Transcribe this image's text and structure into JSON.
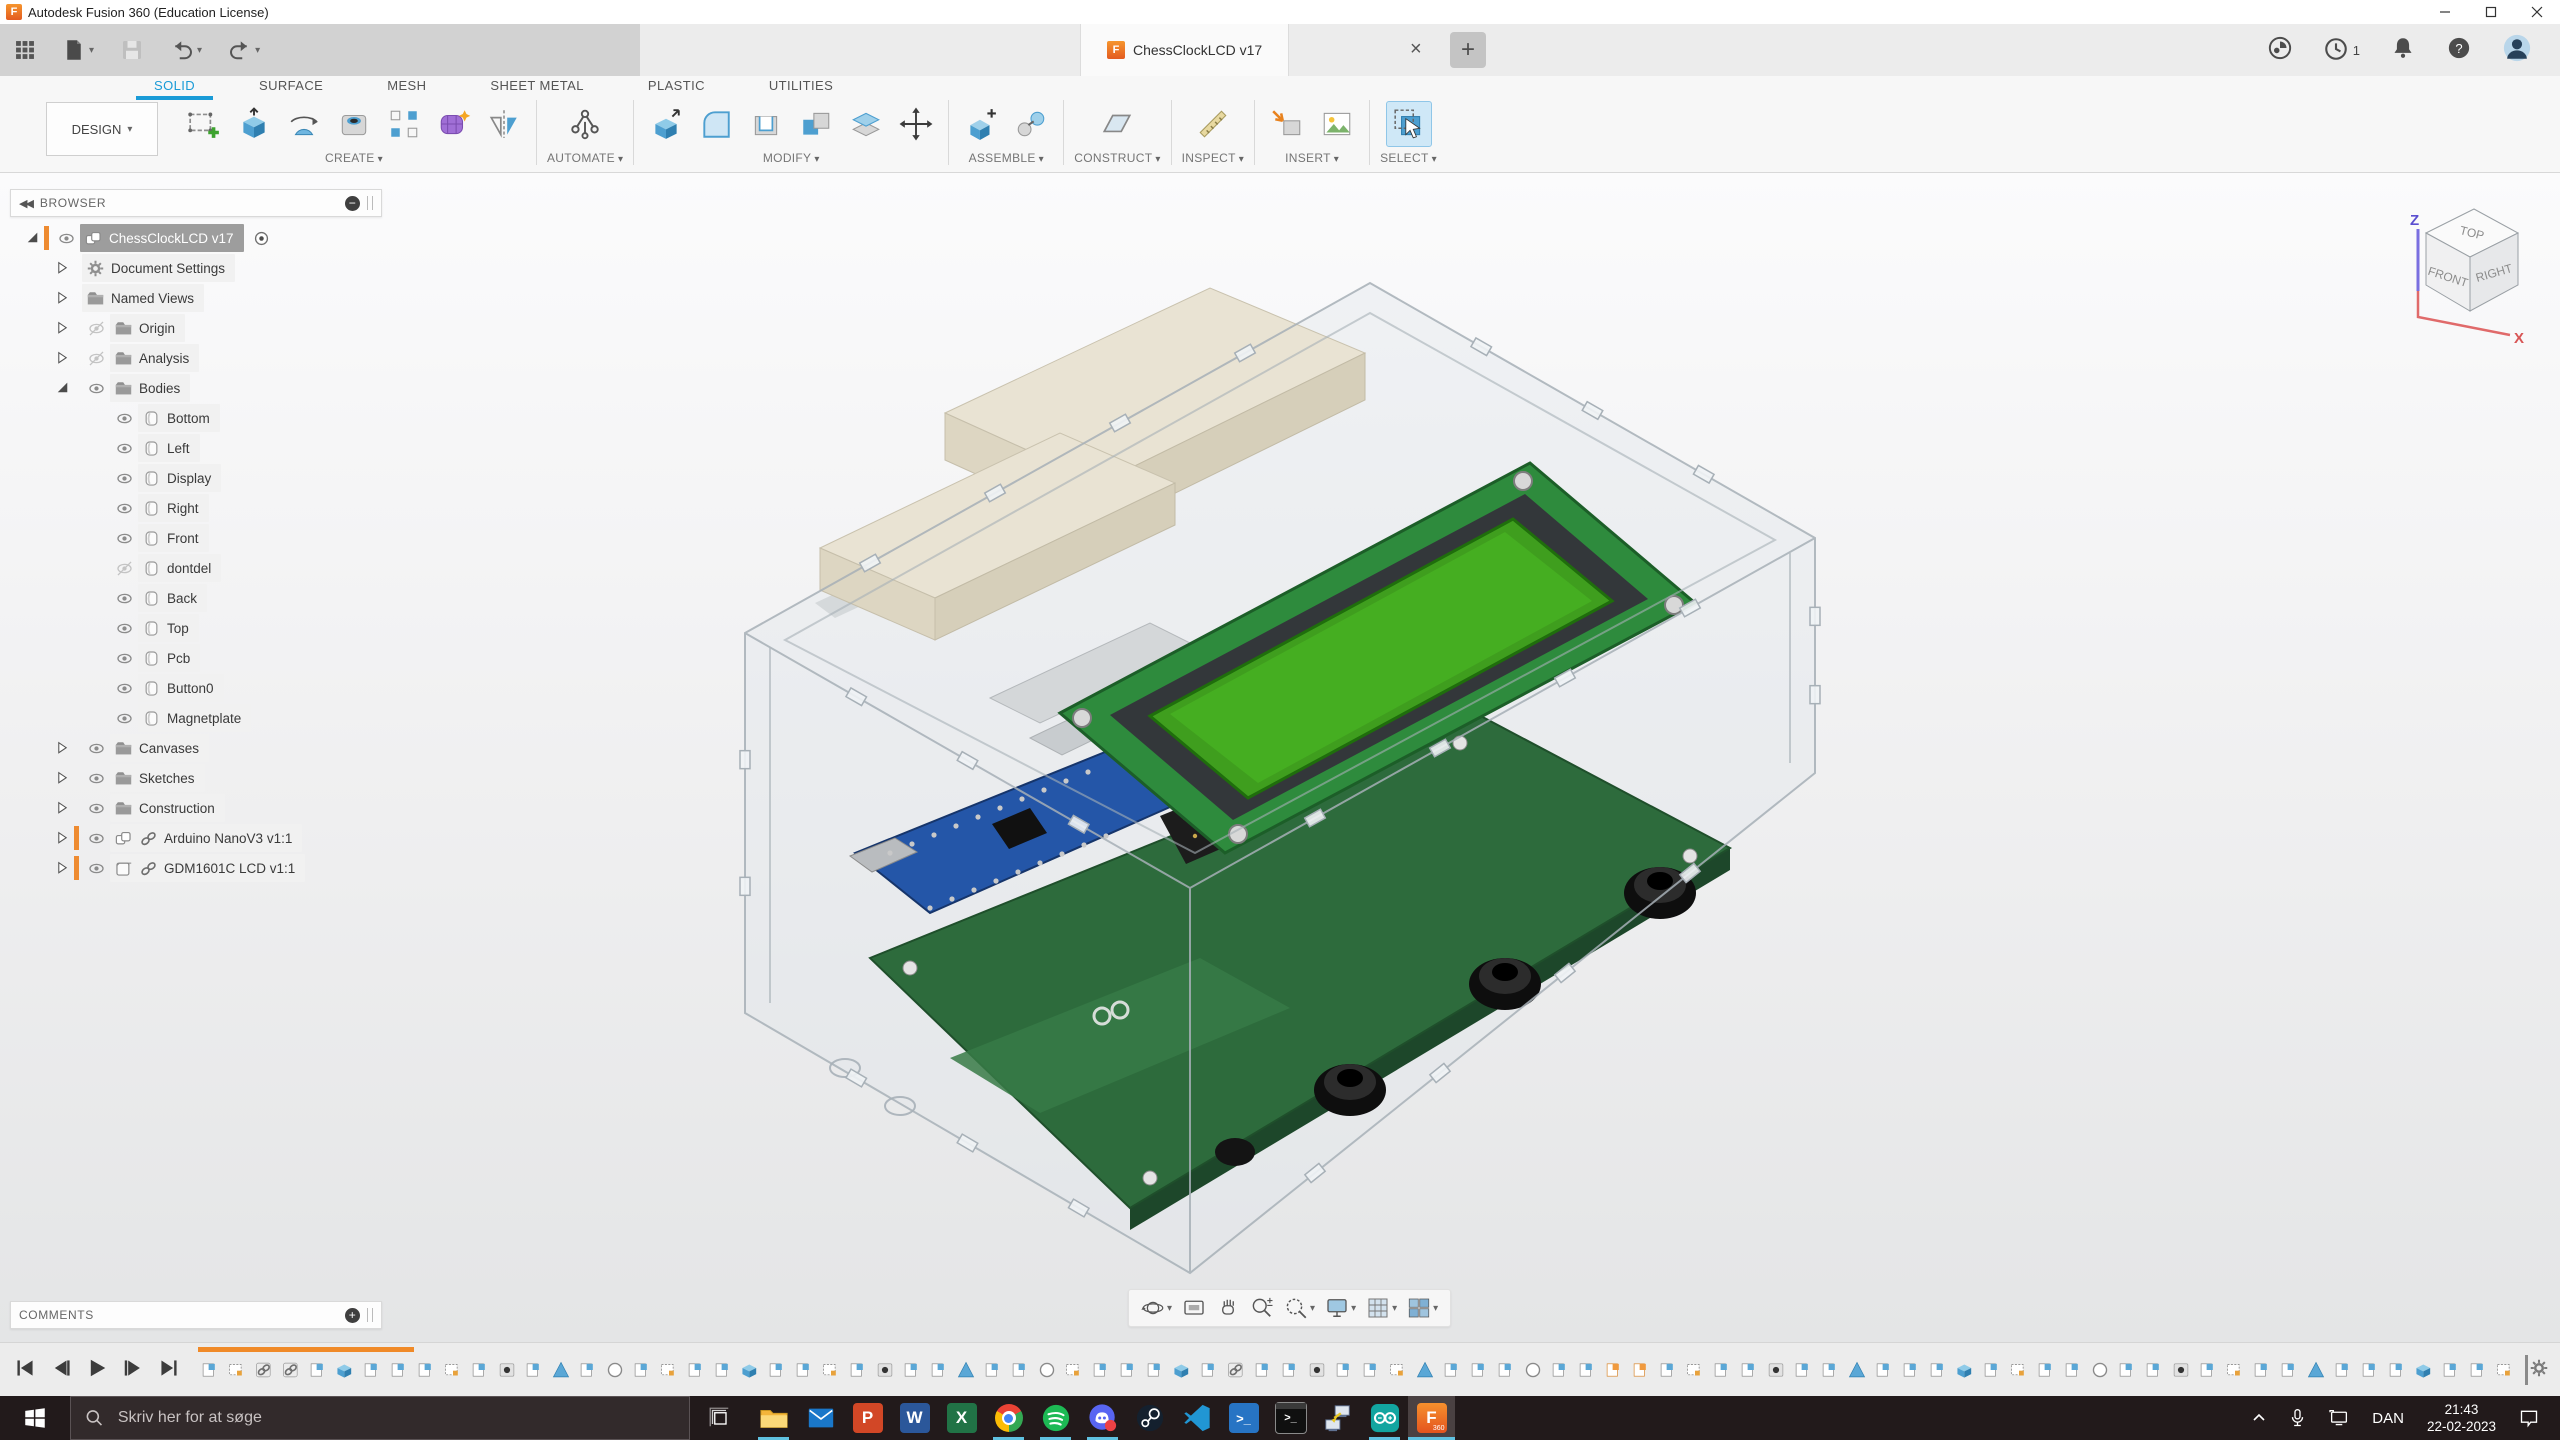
{
  "window": {
    "app_title": "Autodesk Fusion 360 (Education License)"
  },
  "doc_tabs": {
    "active_title": "ChessClockLCD v17",
    "jobs_badge": "1"
  },
  "ribbon": {
    "design_menu": "DESIGN",
    "tabs": [
      {
        "label": "SOLID",
        "active": true
      },
      {
        "label": "SURFACE",
        "active": false
      },
      {
        "label": "MESH",
        "active": false
      },
      {
        "label": "SHEET METAL",
        "active": false
      },
      {
        "label": "PLASTIC",
        "active": false
      },
      {
        "label": "UTILITIES",
        "active": false
      }
    ],
    "groups": [
      {
        "label": "CREATE",
        "icons": [
          "create-sketch",
          "extrude",
          "revolve",
          "hole",
          "pattern",
          "form",
          "mirror"
        ]
      },
      {
        "label": "AUTOMATE",
        "icons": [
          "automate"
        ]
      },
      {
        "label": "MODIFY",
        "icons": [
          "press-pull",
          "fillet",
          "shell",
          "combine",
          "offset-face",
          "move"
        ]
      },
      {
        "label": "ASSEMBLE",
        "icons": [
          "new-component",
          "joint"
        ]
      },
      {
        "label": "CONSTRUCT",
        "icons": [
          "construction-plane"
        ]
      },
      {
        "label": "INSPECT",
        "icons": [
          "measure"
        ]
      },
      {
        "label": "INSERT",
        "icons": [
          "insert-derive",
          "canvas"
        ]
      },
      {
        "label": "SELECT",
        "icons": [
          "select"
        ]
      }
    ]
  },
  "browser": {
    "header": "BROWSER",
    "items": [
      {
        "label": "ChessClockLCD v17",
        "level": 0,
        "exp": "e",
        "eye": "on",
        "icon": "component",
        "link": false,
        "orange": true,
        "selected": true,
        "activate": true
      },
      {
        "label": "Document Settings",
        "level": 1,
        "exp": "c",
        "eye": null,
        "icon": "gear",
        "link": false,
        "orange": false,
        "selected": false,
        "activate": false
      },
      {
        "label": "Named Views",
        "level": 1,
        "exp": "c",
        "eye": null,
        "icon": "folder",
        "link": false,
        "orange": false,
        "selected": false,
        "activate": false
      },
      {
        "label": "Origin",
        "level": 1,
        "exp": "c",
        "eye": "off",
        "icon": "folder",
        "link": false,
        "orange": false,
        "selected": false,
        "activate": false
      },
      {
        "label": "Analysis",
        "level": 1,
        "exp": "c",
        "eye": "off",
        "icon": "folder",
        "link": false,
        "orange": false,
        "selected": false,
        "activate": false
      },
      {
        "label": "Bodies",
        "level": 1,
        "exp": "e",
        "eye": "on",
        "icon": "folder",
        "link": false,
        "orange": false,
        "selected": false,
        "activate": false
      },
      {
        "label": "Bottom",
        "level": 2,
        "exp": null,
        "eye": "on",
        "icon": "body",
        "link": false,
        "orange": false,
        "selected": false,
        "activate": false
      },
      {
        "label": "Left",
        "level": 2,
        "exp": null,
        "eye": "on",
        "icon": "body",
        "link": false,
        "orange": false,
        "selected": false,
        "activate": false
      },
      {
        "label": "Display",
        "level": 2,
        "exp": null,
        "eye": "on",
        "icon": "body",
        "link": false,
        "orange": false,
        "selected": false,
        "activate": false
      },
      {
        "label": "Right",
        "level": 2,
        "exp": null,
        "eye": "on",
        "icon": "body",
        "link": false,
        "orange": false,
        "selected": false,
        "activate": false
      },
      {
        "label": "Front",
        "level": 2,
        "exp": null,
        "eye": "on",
        "icon": "body",
        "link": false,
        "orange": false,
        "selected": false,
        "activate": false
      },
      {
        "label": "dontdel",
        "level": 2,
        "exp": null,
        "eye": "off",
        "icon": "body",
        "link": false,
        "orange": false,
        "selected": false,
        "activate": false
      },
      {
        "label": "Back",
        "level": 2,
        "exp": null,
        "eye": "on",
        "icon": "body",
        "link": false,
        "orange": false,
        "selected": false,
        "activate": false
      },
      {
        "label": "Top",
        "level": 2,
        "exp": null,
        "eye": "on",
        "icon": "body",
        "link": false,
        "orange": false,
        "selected": false,
        "activate": false
      },
      {
        "label": "Pcb",
        "level": 2,
        "exp": null,
        "eye": "on",
        "icon": "body",
        "link": false,
        "orange": false,
        "selected": false,
        "activate": false
      },
      {
        "label": "Button0",
        "level": 2,
        "exp": null,
        "eye": "on",
        "icon": "body",
        "link": false,
        "orange": false,
        "selected": false,
        "activate": false
      },
      {
        "label": "Magnetplate",
        "level": 2,
        "exp": null,
        "eye": "on",
        "icon": "body",
        "link": false,
        "orange": false,
        "selected": false,
        "activate": false
      },
      {
        "label": "Canvases",
        "level": 1,
        "exp": "c",
        "eye": "on",
        "icon": "folder",
        "link": false,
        "orange": false,
        "selected": false,
        "activate": false
      },
      {
        "label": "Sketches",
        "level": 1,
        "exp": "c",
        "eye": "on",
        "icon": "folder",
        "link": false,
        "orange": false,
        "selected": false,
        "activate": false
      },
      {
        "label": "Construction",
        "level": 1,
        "exp": "c",
        "eye": "on",
        "icon": "folder",
        "link": false,
        "orange": false,
        "selected": false,
        "activate": false
      },
      {
        "label": "Arduino NanoV3 v1:1",
        "level": 1,
        "exp": "c",
        "eye": "on",
        "icon": "component",
        "link": true,
        "orange": true,
        "selected": false,
        "activate": false
      },
      {
        "label": "GDM1601C LCD v1:1",
        "level": 1,
        "exp": "c",
        "eye": "on",
        "icon": "cube",
        "link": true,
        "orange": true,
        "selected": false,
        "activate": false
      }
    ]
  },
  "viewcube": {
    "top": "TOP",
    "front": "FRONT",
    "right": "RIGHT",
    "z_axis": "Z",
    "x_axis": "X"
  },
  "comments": {
    "header": "COMMENTS"
  },
  "navbar": {
    "icons": [
      "orbit",
      "look-at",
      "pan",
      "zoom",
      "window-zoom",
      "display-settings",
      "grid-settings",
      "viewports"
    ],
    "dropdown_after": [
      "orbit",
      "window-zoom",
      "display-settings",
      "grid-settings",
      "viewports"
    ]
  },
  "timeline": {
    "icon_count": 86,
    "orange_bar_icons": 8,
    "orange_icon_indices": [
      52,
      53
    ]
  },
  "taskbar": {
    "search_placeholder": "Skriv her for at søge",
    "language": "DAN",
    "time": "21:43",
    "date": "22-02-2023",
    "apps": [
      {
        "name": "file-explorer",
        "running": true,
        "active": false
      },
      {
        "name": "mail",
        "running": false,
        "active": false
      },
      {
        "name": "powerpoint",
        "running": false,
        "active": false
      },
      {
        "name": "word",
        "running": false,
        "active": false
      },
      {
        "name": "excel",
        "running": false,
        "active": false
      },
      {
        "name": "chrome",
        "running": true,
        "active": false
      },
      {
        "name": "spotify",
        "running": true,
        "active": false
      },
      {
        "name": "discord",
        "running": true,
        "active": false
      },
      {
        "name": "steam",
        "running": false,
        "active": false
      },
      {
        "name": "vscode",
        "running": false,
        "active": false
      },
      {
        "name": "powershell",
        "running": false,
        "active": false
      },
      {
        "name": "cmd",
        "running": false,
        "active": false
      },
      {
        "name": "remote-desktop",
        "running": false,
        "active": false
      },
      {
        "name": "arduino-ide",
        "running": true,
        "active": false
      },
      {
        "name": "fusion-360",
        "running": true,
        "active": true
      }
    ]
  },
  "colors": {
    "accent_blue": "#1a9bd7",
    "selection_orange": "#ee8b31",
    "taskbar_underline": "#5fc1e0",
    "lcd_screen_green": "#3f9e1e",
    "pcb_green": "#2d6b3c",
    "fusion_orange": "#f6902d"
  }
}
